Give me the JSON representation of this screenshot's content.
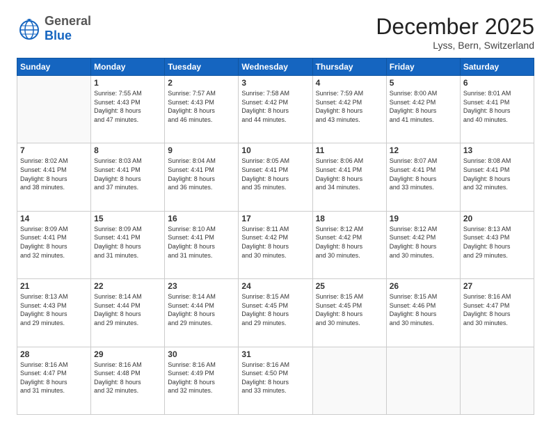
{
  "header": {
    "logo_general": "General",
    "logo_blue": "Blue",
    "month_title": "December 2025",
    "location": "Lyss, Bern, Switzerland"
  },
  "days_of_week": [
    "Sunday",
    "Monday",
    "Tuesday",
    "Wednesday",
    "Thursday",
    "Friday",
    "Saturday"
  ],
  "weeks": [
    [
      {
        "day": "",
        "info": ""
      },
      {
        "day": "1",
        "info": "Sunrise: 7:55 AM\nSunset: 4:43 PM\nDaylight: 8 hours\nand 47 minutes."
      },
      {
        "day": "2",
        "info": "Sunrise: 7:57 AM\nSunset: 4:43 PM\nDaylight: 8 hours\nand 46 minutes."
      },
      {
        "day": "3",
        "info": "Sunrise: 7:58 AM\nSunset: 4:42 PM\nDaylight: 8 hours\nand 44 minutes."
      },
      {
        "day": "4",
        "info": "Sunrise: 7:59 AM\nSunset: 4:42 PM\nDaylight: 8 hours\nand 43 minutes."
      },
      {
        "day": "5",
        "info": "Sunrise: 8:00 AM\nSunset: 4:42 PM\nDaylight: 8 hours\nand 41 minutes."
      },
      {
        "day": "6",
        "info": "Sunrise: 8:01 AM\nSunset: 4:41 PM\nDaylight: 8 hours\nand 40 minutes."
      }
    ],
    [
      {
        "day": "7",
        "info": "Sunrise: 8:02 AM\nSunset: 4:41 PM\nDaylight: 8 hours\nand 38 minutes."
      },
      {
        "day": "8",
        "info": "Sunrise: 8:03 AM\nSunset: 4:41 PM\nDaylight: 8 hours\nand 37 minutes."
      },
      {
        "day": "9",
        "info": "Sunrise: 8:04 AM\nSunset: 4:41 PM\nDaylight: 8 hours\nand 36 minutes."
      },
      {
        "day": "10",
        "info": "Sunrise: 8:05 AM\nSunset: 4:41 PM\nDaylight: 8 hours\nand 35 minutes."
      },
      {
        "day": "11",
        "info": "Sunrise: 8:06 AM\nSunset: 4:41 PM\nDaylight: 8 hours\nand 34 minutes."
      },
      {
        "day": "12",
        "info": "Sunrise: 8:07 AM\nSunset: 4:41 PM\nDaylight: 8 hours\nand 33 minutes."
      },
      {
        "day": "13",
        "info": "Sunrise: 8:08 AM\nSunset: 4:41 PM\nDaylight: 8 hours\nand 32 minutes."
      }
    ],
    [
      {
        "day": "14",
        "info": "Sunrise: 8:09 AM\nSunset: 4:41 PM\nDaylight: 8 hours\nand 32 minutes."
      },
      {
        "day": "15",
        "info": "Sunrise: 8:09 AM\nSunset: 4:41 PM\nDaylight: 8 hours\nand 31 minutes."
      },
      {
        "day": "16",
        "info": "Sunrise: 8:10 AM\nSunset: 4:41 PM\nDaylight: 8 hours\nand 31 minutes."
      },
      {
        "day": "17",
        "info": "Sunrise: 8:11 AM\nSunset: 4:42 PM\nDaylight: 8 hours\nand 30 minutes."
      },
      {
        "day": "18",
        "info": "Sunrise: 8:12 AM\nSunset: 4:42 PM\nDaylight: 8 hours\nand 30 minutes."
      },
      {
        "day": "19",
        "info": "Sunrise: 8:12 AM\nSunset: 4:42 PM\nDaylight: 8 hours\nand 30 minutes."
      },
      {
        "day": "20",
        "info": "Sunrise: 8:13 AM\nSunset: 4:43 PM\nDaylight: 8 hours\nand 29 minutes."
      }
    ],
    [
      {
        "day": "21",
        "info": "Sunrise: 8:13 AM\nSunset: 4:43 PM\nDaylight: 8 hours\nand 29 minutes."
      },
      {
        "day": "22",
        "info": "Sunrise: 8:14 AM\nSunset: 4:44 PM\nDaylight: 8 hours\nand 29 minutes."
      },
      {
        "day": "23",
        "info": "Sunrise: 8:14 AM\nSunset: 4:44 PM\nDaylight: 8 hours\nand 29 minutes."
      },
      {
        "day": "24",
        "info": "Sunrise: 8:15 AM\nSunset: 4:45 PM\nDaylight: 8 hours\nand 29 minutes."
      },
      {
        "day": "25",
        "info": "Sunrise: 8:15 AM\nSunset: 4:45 PM\nDaylight: 8 hours\nand 30 minutes."
      },
      {
        "day": "26",
        "info": "Sunrise: 8:15 AM\nSunset: 4:46 PM\nDaylight: 8 hours\nand 30 minutes."
      },
      {
        "day": "27",
        "info": "Sunrise: 8:16 AM\nSunset: 4:47 PM\nDaylight: 8 hours\nand 30 minutes."
      }
    ],
    [
      {
        "day": "28",
        "info": "Sunrise: 8:16 AM\nSunset: 4:47 PM\nDaylight: 8 hours\nand 31 minutes."
      },
      {
        "day": "29",
        "info": "Sunrise: 8:16 AM\nSunset: 4:48 PM\nDaylight: 8 hours\nand 32 minutes."
      },
      {
        "day": "30",
        "info": "Sunrise: 8:16 AM\nSunset: 4:49 PM\nDaylight: 8 hours\nand 32 minutes."
      },
      {
        "day": "31",
        "info": "Sunrise: 8:16 AM\nSunset: 4:50 PM\nDaylight: 8 hours\nand 33 minutes."
      },
      {
        "day": "",
        "info": ""
      },
      {
        "day": "",
        "info": ""
      },
      {
        "day": "",
        "info": ""
      }
    ]
  ]
}
